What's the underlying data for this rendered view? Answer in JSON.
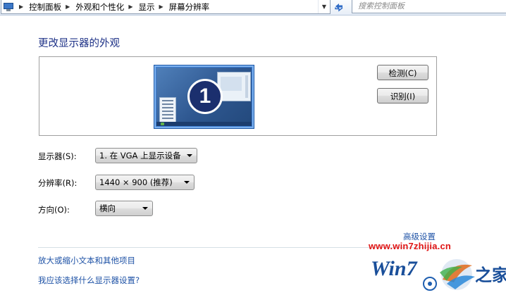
{
  "address_bar": {
    "breadcrumbs": [
      "控制面板",
      "外观和个性化",
      "显示",
      "屏幕分辨率"
    ]
  },
  "search": {
    "placeholder": "搜索控制面板"
  },
  "main": {
    "title": "更改显示器的外观",
    "monitor_number": "1",
    "detect_button": "检测(C)",
    "identify_button": "识别(I)",
    "display": {
      "label": "显示器(S):",
      "value": "1. 在 VGA 上显示设备"
    },
    "resolution": {
      "label": "分辨率(R):",
      "value": "1440 × 900 (推荐)"
    },
    "orientation": {
      "label": "方向(O):",
      "value": "横向"
    },
    "advanced_link": "高级设置",
    "links": [
      "放大或缩小文本和其他项目",
      "我应该选择什么显示器设置?"
    ]
  },
  "watermark": {
    "url": "www.win7zhijia.cn",
    "logo_text": "Win7之家"
  },
  "colors": {
    "title": "#1e3287",
    "link": "#1e52a6",
    "watermark_url": "#e01414",
    "monitor_frame": "#3b7bd0"
  }
}
